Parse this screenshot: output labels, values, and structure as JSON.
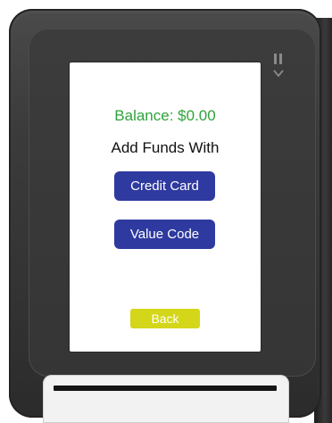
{
  "screen": {
    "balance_text": "Balance: $0.00",
    "add_funds_text": "Add Funds With",
    "credit_card_label": "Credit Card",
    "value_code_label": "Value Code",
    "back_label": "Back"
  },
  "colors": {
    "balance_green": "#2fa33a",
    "button_blue": "#2f3aa0",
    "back_yellow": "#d4d61a",
    "device_gray": "#3b3b3b"
  },
  "icons": {
    "indicator_top": "pause-bars-icon",
    "indicator_bottom": "chevron-down-icon"
  }
}
